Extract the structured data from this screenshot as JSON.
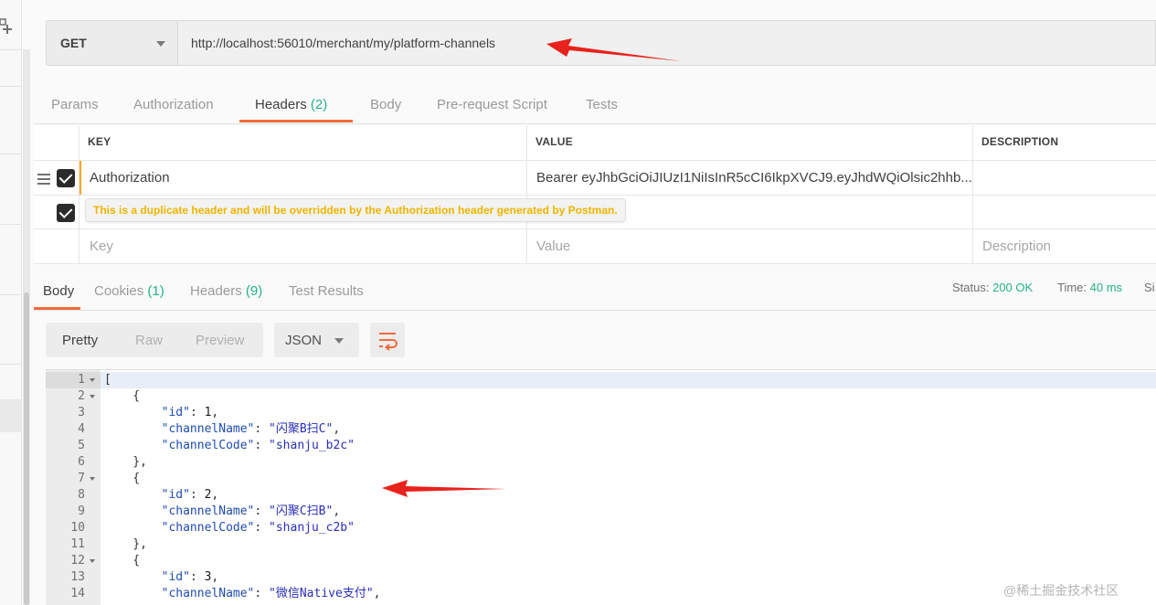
{
  "request": {
    "method": "GET",
    "url": "http://localhost:56010/merchant/my/platform-channels"
  },
  "request_tabs": [
    {
      "label": "Params",
      "count": ""
    },
    {
      "label": "Authorization",
      "count": ""
    },
    {
      "label": "Headers",
      "count": "(2)"
    },
    {
      "label": "Body",
      "count": ""
    },
    {
      "label": "Pre-request Script",
      "count": ""
    },
    {
      "label": "Tests",
      "count": ""
    }
  ],
  "headers_table": {
    "columns": [
      "KEY",
      "VALUE",
      "DESCRIPTION"
    ],
    "rows": [
      {
        "key": "Authorization",
        "value": "Bearer eyJhbGciOiJIUzI1NiIsInR5cCI6IkpXVCJ9.eyJhdWQiOlsic2hhb...",
        "checked": true
      },
      {
        "key": "",
        "value": "",
        "checked": true
      }
    ],
    "warning": "This is a duplicate header and will be overridden by the Authorization header generated by Postman.",
    "placeholder": {
      "key": "Key",
      "value": "Value",
      "description": "Description"
    }
  },
  "response_tabs": [
    {
      "label": "Body",
      "count": ""
    },
    {
      "label": "Cookies",
      "count": "(1)"
    },
    {
      "label": "Headers",
      "count": "(9)"
    },
    {
      "label": "Test Results",
      "count": ""
    }
  ],
  "status": {
    "status_label": "Status:",
    "status_value": "200 OK",
    "time_label": "Time:",
    "time_value": "40 ms",
    "size_label": "Si"
  },
  "view": {
    "modes": [
      "Pretty",
      "Raw",
      "Preview"
    ],
    "active": "Pretty",
    "format": "JSON"
  },
  "code_lines": [
    {
      "n": "1",
      "fold": true,
      "text": "["
    },
    {
      "n": "2",
      "fold": true,
      "text": "    {"
    },
    {
      "n": "3",
      "fold": false,
      "text": "        \"id\": 1,"
    },
    {
      "n": "4",
      "fold": false,
      "text": "        \"channelName\": \"闪聚B扫C\","
    },
    {
      "n": "5",
      "fold": false,
      "text": "        \"channelCode\": \"shanju_b2c\""
    },
    {
      "n": "6",
      "fold": false,
      "text": "    },"
    },
    {
      "n": "7",
      "fold": true,
      "text": "    {"
    },
    {
      "n": "8",
      "fold": false,
      "text": "        \"id\": 2,"
    },
    {
      "n": "9",
      "fold": false,
      "text": "        \"channelName\": \"闪聚C扫B\","
    },
    {
      "n": "10",
      "fold": false,
      "text": "        \"channelCode\": \"shanju_c2b\""
    },
    {
      "n": "11",
      "fold": false,
      "text": "    },"
    },
    {
      "n": "12",
      "fold": true,
      "text": "    {"
    },
    {
      "n": "13",
      "fold": false,
      "text": "        \"id\": 3,"
    },
    {
      "n": "14",
      "fold": false,
      "text": "        \"channelName\": \"微信Native支付\","
    }
  ],
  "watermark": "@稀土掘金技术社区",
  "colors": {
    "accent": "#f26b3a",
    "success": "#26b47f",
    "warning": "#f0b400",
    "arrow": "#e8221c"
  }
}
